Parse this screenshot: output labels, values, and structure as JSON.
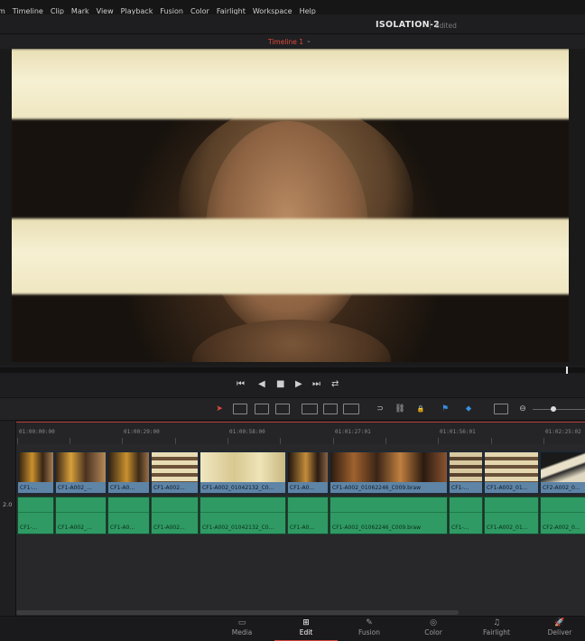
{
  "menu": [
    "m",
    "Timeline",
    "Clip",
    "Mark",
    "View",
    "Playback",
    "Fusion",
    "Color",
    "Fairlight",
    "Workspace",
    "Help"
  ],
  "project": {
    "title": "ISOLATION-2",
    "status": "Edited"
  },
  "viewer": {
    "timeline_name": "Timeline 1",
    "chevron": "⌄"
  },
  "transport": {
    "first_frame": "⏮",
    "play_reverse": "◀",
    "stop": "■",
    "play": "▶",
    "last_frame": "⏭",
    "loop": "⇄"
  },
  "toolbar": {
    "select": "➤",
    "snap": "⊃",
    "link": "⛓",
    "lock": "🔒",
    "flag": "⚑",
    "marker": "⬥",
    "zoom_out": "⊖"
  },
  "ruler": [
    "01:00:00:00",
    "01:00:29:00",
    "01:00:58:00",
    "01:01:27:01",
    "01:01:56:01",
    "01:02:25:02"
  ],
  "tracks": {
    "a1_label": "2.0"
  },
  "video_clips": [
    "CF1-...",
    "CF1-A002_...",
    "CF1-A0...",
    "CF1-A002...",
    "CF1-A002_01042132_C0...",
    "CF1-A0...",
    "CF1-A002_01062246_C009.braw",
    "CF1-...",
    "CF1-A002_01...",
    "CF2-A002_0..."
  ],
  "audio_clips": [
    "CF1-...",
    "CF1-A002_...",
    "CF1-A0...",
    "CF1-A002...",
    "CF1-A002_01042132_C0...",
    "CF1-A0...",
    "CF1-A002_01062246_C009.braw",
    "CF1-...",
    "CF1-A002_01...",
    "CF2-A002_0..."
  ],
  "pages": [
    {
      "label": "Media",
      "icon": "▭"
    },
    {
      "label": "Edit",
      "icon": "⊞"
    },
    {
      "label": "Fusion",
      "icon": "✎"
    },
    {
      "label": "Color",
      "icon": "◎"
    },
    {
      "label": "Fairlight",
      "icon": "♫"
    },
    {
      "label": "Deliver",
      "icon": "🚀"
    }
  ],
  "active_page": "Edit",
  "colors": {
    "accent": "#d2453a",
    "video_clip": "#5e84a6",
    "audio_clip": "#2f9a63",
    "timeline_name": "#e04a3a"
  }
}
